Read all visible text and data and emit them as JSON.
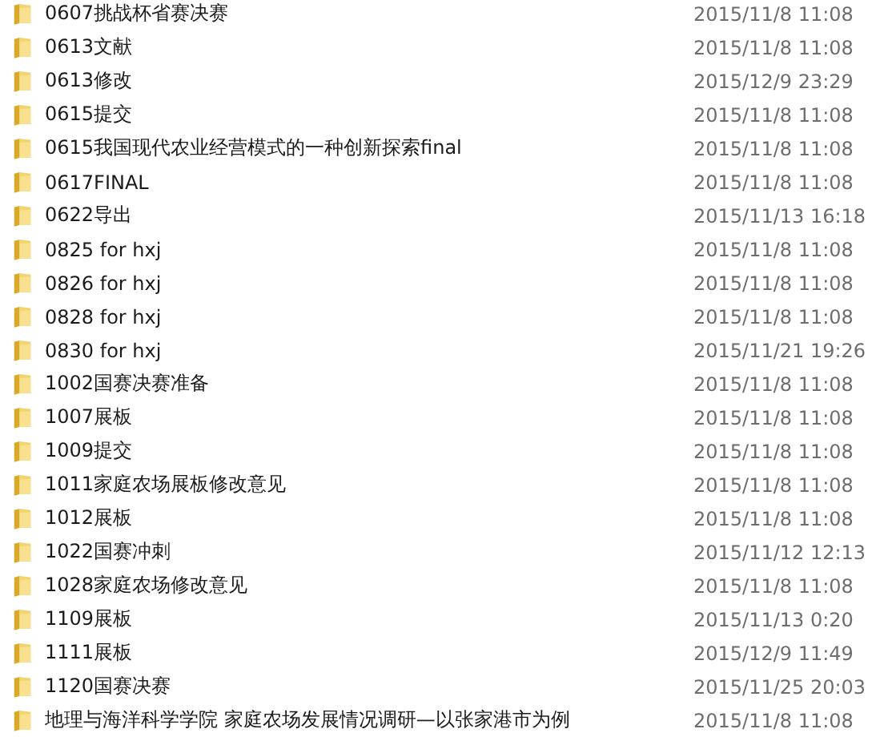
{
  "files": [
    {
      "name": "0607挑战杯省赛决赛",
      "modified": "2015/11/8 11:08"
    },
    {
      "name": "0613文献",
      "modified": "2015/11/8 11:08"
    },
    {
      "name": "0613修改",
      "modified": "2015/12/9 23:29"
    },
    {
      "name": "0615提交",
      "modified": "2015/11/8 11:08"
    },
    {
      "name": "0615我国现代农业经营模式的一种创新探索final",
      "modified": "2015/11/8 11:08"
    },
    {
      "name": "0617FINAL",
      "modified": "2015/11/8 11:08"
    },
    {
      "name": "0622导出",
      "modified": "2015/11/13 16:18"
    },
    {
      "name": "0825 for hxj",
      "modified": "2015/11/8 11:08"
    },
    {
      "name": "0826 for hxj",
      "modified": "2015/11/8 11:08"
    },
    {
      "name": "0828 for hxj",
      "modified": "2015/11/8 11:08"
    },
    {
      "name": "0830 for hxj",
      "modified": "2015/11/21 19:26"
    },
    {
      "name": "1002国赛决赛准备",
      "modified": "2015/11/8 11:08"
    },
    {
      "name": "1007展板",
      "modified": "2015/11/8 11:08"
    },
    {
      "name": "1009提交",
      "modified": "2015/11/8 11:08"
    },
    {
      "name": "1011家庭农场展板修改意见",
      "modified": "2015/11/8 11:08"
    },
    {
      "name": "1012展板",
      "modified": "2015/11/8 11:08"
    },
    {
      "name": "1022国赛冲刺",
      "modified": "2015/11/12 12:13"
    },
    {
      "name": "1028家庭农场修改意见",
      "modified": "2015/11/8 11:08"
    },
    {
      "name": "1109展板",
      "modified": "2015/11/13 0:20"
    },
    {
      "name": "1111展板",
      "modified": "2015/12/9 11:49"
    },
    {
      "name": "1120国赛决赛",
      "modified": "2015/11/25 20:03"
    },
    {
      "name": "地理与海洋科学学院  家庭农场发展情况调研—以张家港市为例",
      "modified": "2015/11/8 11:08"
    }
  ]
}
